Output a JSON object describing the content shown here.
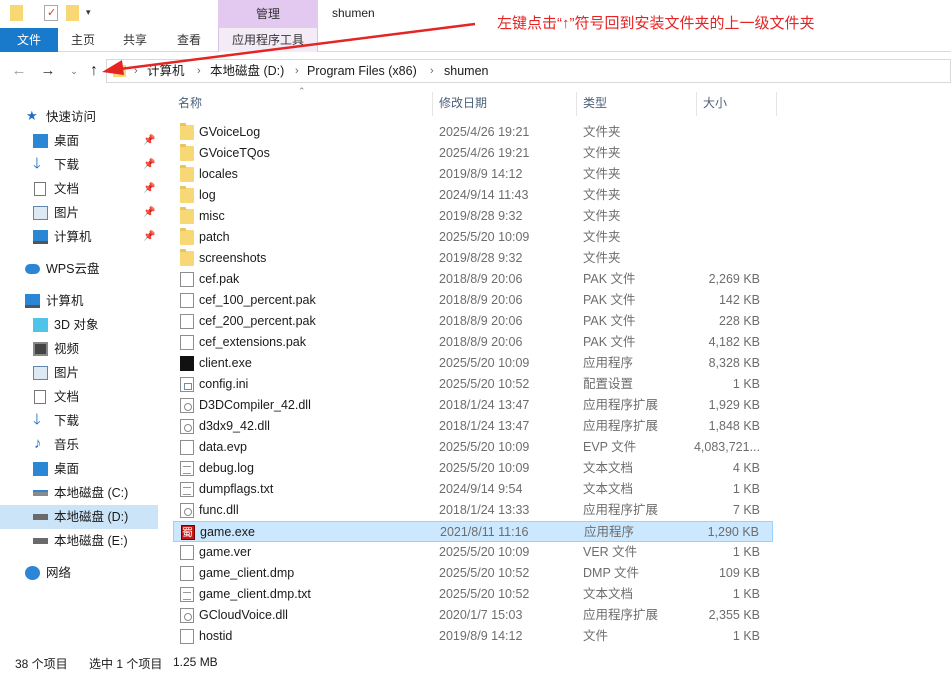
{
  "window": {
    "title": "shumen",
    "manage_tab": "管理"
  },
  "ribbon": {
    "tabs": [
      "文件",
      "主页",
      "共享",
      "查看",
      "应用程序工具"
    ]
  },
  "annotation": {
    "text": "左键点击“↑”符号回到安装文件夹的上一级文件夹",
    "color": "#e52424"
  },
  "address": {
    "crumbs": [
      "计算机",
      "本地磁盘 (D:)",
      "Program Files (x86)",
      "shumen"
    ]
  },
  "sidebar": {
    "quick_access": "快速访问",
    "quick_items": [
      "桌面",
      "下载",
      "文档",
      "图片",
      "计算机"
    ],
    "wps": "WPS云盘",
    "this_pc": "计算机",
    "pc_items": [
      "3D 对象",
      "视频",
      "图片",
      "文档",
      "下载",
      "音乐",
      "桌面",
      "本地磁盘 (C:)",
      "本地磁盘 (D:)",
      "本地磁盘 (E:)"
    ],
    "network": "网络",
    "selected": "本地磁盘 (D:)"
  },
  "columns": {
    "name": "名称",
    "date": "修改日期",
    "type": "类型",
    "size": "大小"
  },
  "files": [
    {
      "name": "GVoiceLog",
      "date": "2025/4/26 19:21",
      "type": "文件夹",
      "size": "",
      "icon": "folder-icon"
    },
    {
      "name": "GVoiceTQos",
      "date": "2025/4/26 19:21",
      "type": "文件夹",
      "size": "",
      "icon": "folder-icon"
    },
    {
      "name": "locales",
      "date": "2019/8/9 14:12",
      "type": "文件夹",
      "size": "",
      "icon": "folder-icon"
    },
    {
      "name": "log",
      "date": "2024/9/14 11:43",
      "type": "文件夹",
      "size": "",
      "icon": "folder-icon"
    },
    {
      "name": "misc",
      "date": "2019/8/28 9:32",
      "type": "文件夹",
      "size": "",
      "icon": "folder-icon"
    },
    {
      "name": "patch",
      "date": "2025/5/20 10:09",
      "type": "文件夹",
      "size": "",
      "icon": "folder-icon"
    },
    {
      "name": "screenshots",
      "date": "2019/8/28 9:32",
      "type": "文件夹",
      "size": "",
      "icon": "folder-icon"
    },
    {
      "name": "cef.pak",
      "date": "2018/8/9 20:06",
      "type": "PAK 文件",
      "size": "2,269 KB",
      "icon": "file-icon"
    },
    {
      "name": "cef_100_percent.pak",
      "date": "2018/8/9 20:06",
      "type": "PAK 文件",
      "size": "142 KB",
      "icon": "file-icon"
    },
    {
      "name": "cef_200_percent.pak",
      "date": "2018/8/9 20:06",
      "type": "PAK 文件",
      "size": "228 KB",
      "icon": "file-icon"
    },
    {
      "name": "cef_extensions.pak",
      "date": "2018/8/9 20:06",
      "type": "PAK 文件",
      "size": "4,182 KB",
      "icon": "file-icon"
    },
    {
      "name": "client.exe",
      "date": "2025/5/20 10:09",
      "type": "应用程序",
      "size": "8,328 KB",
      "icon": "exe-icon"
    },
    {
      "name": "config.ini",
      "date": "2025/5/20 10:52",
      "type": "配置设置",
      "size": "1 KB",
      "icon": "ini-icon"
    },
    {
      "name": "D3DCompiler_42.dll",
      "date": "2018/1/24 13:47",
      "type": "应用程序扩展",
      "size": "1,929 KB",
      "icon": "dll-icon"
    },
    {
      "name": "d3dx9_42.dll",
      "date": "2018/1/24 13:47",
      "type": "应用程序扩展",
      "size": "1,848 KB",
      "icon": "dll-icon"
    },
    {
      "name": "data.evp",
      "date": "2025/5/20 10:09",
      "type": "EVP 文件",
      "size": "4,083,721...",
      "icon": "file-icon"
    },
    {
      "name": "debug.log",
      "date": "2025/5/20 10:09",
      "type": "文本文档",
      "size": "4 KB",
      "icon": "text-icon"
    },
    {
      "name": "dumpflags.txt",
      "date": "2024/9/14 9:54",
      "type": "文本文档",
      "size": "1 KB",
      "icon": "text-icon"
    },
    {
      "name": "func.dll",
      "date": "2018/1/24 13:33",
      "type": "应用程序扩展",
      "size": "7 KB",
      "icon": "dll-icon"
    },
    {
      "name": "game.exe",
      "date": "2021/8/11 11:16",
      "type": "应用程序",
      "size": "1,290 KB",
      "icon": "game-icon"
    },
    {
      "name": "game.ver",
      "date": "2025/5/20 10:09",
      "type": "VER 文件",
      "size": "1 KB",
      "icon": "file-icon"
    },
    {
      "name": "game_client.dmp",
      "date": "2025/5/20 10:52",
      "type": "DMP 文件",
      "size": "109 KB",
      "icon": "file-icon"
    },
    {
      "name": "game_client.dmp.txt",
      "date": "2025/5/20 10:52",
      "type": "文本文档",
      "size": "1 KB",
      "icon": "text-icon"
    },
    {
      "name": "GCloudVoice.dll",
      "date": "2020/1/7 15:03",
      "type": "应用程序扩展",
      "size": "2,355 KB",
      "icon": "dll-icon"
    },
    {
      "name": "hostid",
      "date": "2019/8/9 14:12",
      "type": "文件",
      "size": "1 KB",
      "icon": "file-icon"
    }
  ],
  "selected_file": "game.exe",
  "status": {
    "count": "38 个项目",
    "selection": "选中 1 个项目",
    "selection_size": "1.25 MB"
  }
}
